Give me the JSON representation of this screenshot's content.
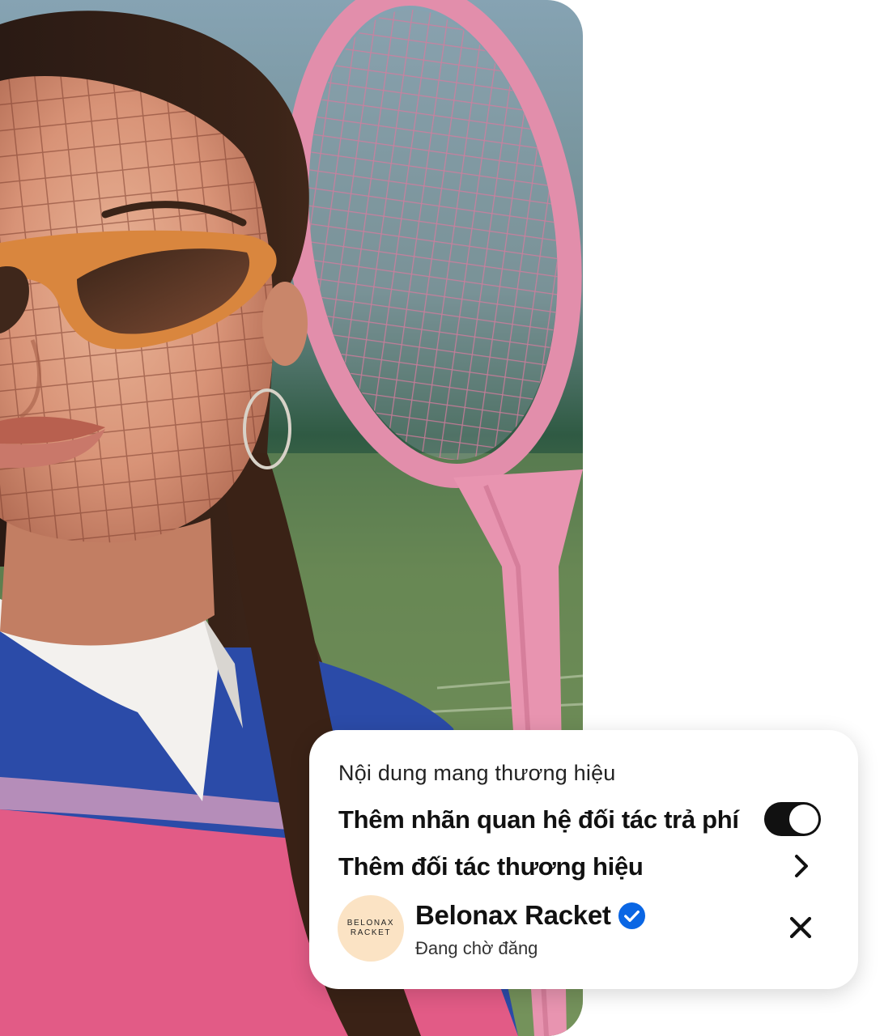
{
  "panel": {
    "title": "Nội dung mang thương hiệu",
    "paid_partnership_label": "Thêm nhãn quan hệ đối tác trả phí",
    "paid_partnership_enabled": true,
    "add_partner_label": "Thêm đối tác thương hiệu",
    "partner": {
      "logo_line_1": "BELONAX",
      "logo_line_2": "RACKET",
      "name": "Belonax Racket",
      "verified": true,
      "status": "Đang chờ đăng"
    }
  },
  "icons": {
    "toggle": "toggle-switch-on",
    "chevron": "chevron-right-icon",
    "verified": "verified-badge-icon",
    "close": "close-icon"
  },
  "colors": {
    "toggle_on": "#111111",
    "verified_blue": "#0a66e4",
    "avatar_bg": "#fbe3c4"
  }
}
